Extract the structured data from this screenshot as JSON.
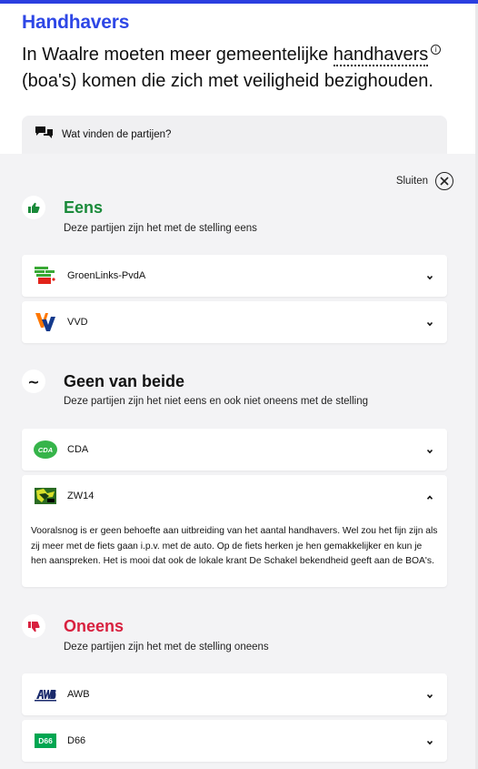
{
  "header": {
    "brand": "Handhavers",
    "statement_before": "In Waalre moeten meer gemeentelijke ",
    "statement_term": "handhavers",
    "statement_after": " (boa's) komen die zich met veiligheid bezighouden.",
    "info_glyph": "i"
  },
  "parties_toggle": {
    "label": "Wat vinden de partijen?"
  },
  "close": {
    "label": "Sluiten"
  },
  "groups": [
    {
      "title": "Eens",
      "subtitle": "Deze partijen zijn het met de stelling eens",
      "icon": "thumbs-up-icon",
      "color": "#1a8a3a",
      "parties": [
        {
          "name": "GroenLinks-PvdA",
          "logo": "groenlinks-pvda-logo",
          "expanded": false
        },
        {
          "name": "VVD",
          "logo": "vvd-logo",
          "expanded": false
        }
      ]
    },
    {
      "title": "Geen van beide",
      "subtitle": "Deze partijen zijn het niet eens en ook niet oneens met de stelling",
      "icon": "tilde-icon",
      "glyph": "~",
      "color": "#111111",
      "parties": [
        {
          "name": "CDA",
          "logo": "cda-logo",
          "logo_text": "CDA",
          "expanded": false
        },
        {
          "name": "ZW14",
          "logo": "zw14-logo",
          "expanded": true,
          "explanation": "Vooralsnog is er geen behoefte aan uitbreiding van het aantal handhavers. Wel zou het fijn zijn als zij meer met de fiets gaan i.p.v. met de auto. Op de fiets herken je hen gemakkelijker en kun je hen aanspreken. Het is mooi dat ook de lokale krant De Schakel bekendheid geeft aan de BOA's."
        }
      ]
    },
    {
      "title": "Oneens",
      "subtitle": "Deze partijen zijn het met de stelling oneens",
      "icon": "thumbs-down-icon",
      "color": "#d8213f",
      "parties": [
        {
          "name": "AWB",
          "logo": "awb-logo",
          "expanded": false
        },
        {
          "name": "D66",
          "logo": "d66-logo",
          "logo_text": "D66",
          "expanded": false
        }
      ]
    }
  ],
  "colors": {
    "brand_blue": "#2e47e6",
    "panel_bg": "#f3f3f5",
    "cda_green": "#36b44a",
    "d66_green": "#00a651"
  }
}
